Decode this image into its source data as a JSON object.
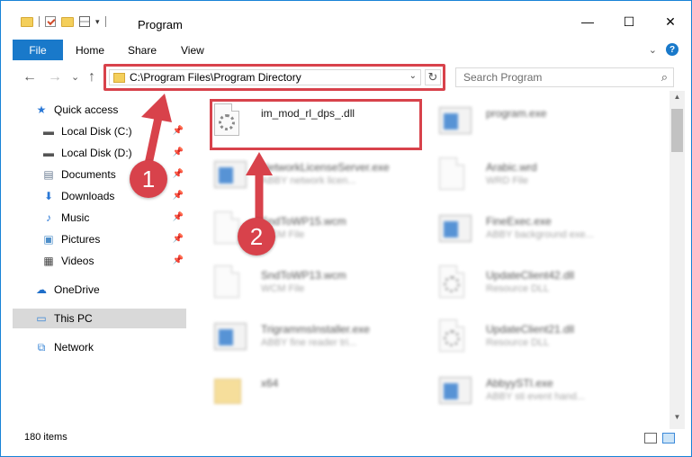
{
  "window": {
    "title": "Program",
    "controls": {
      "minimize": "—",
      "maximize": "☐",
      "close": "✕"
    }
  },
  "ribbon": {
    "file": "File",
    "tabs": [
      "Home",
      "Share",
      "View"
    ],
    "help": "?"
  },
  "navigation": {
    "back": "←",
    "forward": "→",
    "up_list": "⌄",
    "up": "↑",
    "address": "C:\\Program Files\\Program Directory",
    "refresh": "↻",
    "search_placeholder": "Search Program"
  },
  "sidebar": {
    "items": [
      {
        "label": "Quick access",
        "icon": "star-icon"
      },
      {
        "label": "Local Disk (C:)",
        "icon": "drive-icon",
        "pinned": true
      },
      {
        "label": "Local Disk (D:)",
        "icon": "drive-icon",
        "pinned": true
      },
      {
        "label": "Documents",
        "icon": "documents-icon",
        "pinned": true
      },
      {
        "label": "Downloads",
        "icon": "download-icon",
        "pinned": true
      },
      {
        "label": "Music",
        "icon": "music-icon",
        "pinned": true
      },
      {
        "label": "Pictures",
        "icon": "pictures-icon",
        "pinned": true
      },
      {
        "label": "Videos",
        "icon": "videos-icon",
        "pinned": true
      },
      {
        "label": "OneDrive",
        "icon": "cloud-icon"
      },
      {
        "label": "This PC",
        "icon": "computer-icon",
        "selected": true
      },
      {
        "label": "Network",
        "icon": "network-icon"
      }
    ]
  },
  "files": [
    {
      "name": "im_mod_rl_dps_.dll",
      "sub": "",
      "icon": "dll-icon"
    },
    {
      "name": "program.exe",
      "sub": "",
      "icon": "exe-icon"
    },
    {
      "name": "NetworkLicenseServer.exe",
      "sub": "ABBY network licen...",
      "icon": "exe-icon"
    },
    {
      "name": "Arabic.wrd",
      "sub": "WRD File",
      "icon": "file-icon"
    },
    {
      "name": "SndToWP15.wcm",
      "sub": "WCM File",
      "icon": "file-icon"
    },
    {
      "name": "FineExec.exe",
      "sub": "ABBY background exe...",
      "icon": "exe-icon"
    },
    {
      "name": "SndToWP13.wcm",
      "sub": "WCM File",
      "icon": "file-icon"
    },
    {
      "name": "UpdateClient42.dll",
      "sub": "Resource DLL",
      "icon": "dll-icon"
    },
    {
      "name": "TrigrammsInstaller.exe",
      "sub": "ABBY fine reader tri...",
      "icon": "exe-icon"
    },
    {
      "name": "UpdateClient21.dll",
      "sub": "Resource DLL",
      "icon": "dll-icon"
    },
    {
      "name": "x64",
      "sub": "",
      "icon": "folder-icon"
    },
    {
      "name": "AbbyySTI.exe",
      "sub": "ABBY sti event hand...",
      "icon": "exe-icon"
    }
  ],
  "status": {
    "item_count": "180 items"
  },
  "callouts": {
    "one": "1",
    "two": "2"
  },
  "colors": {
    "accent": "#1979ca",
    "highlight": "#d8424b"
  }
}
